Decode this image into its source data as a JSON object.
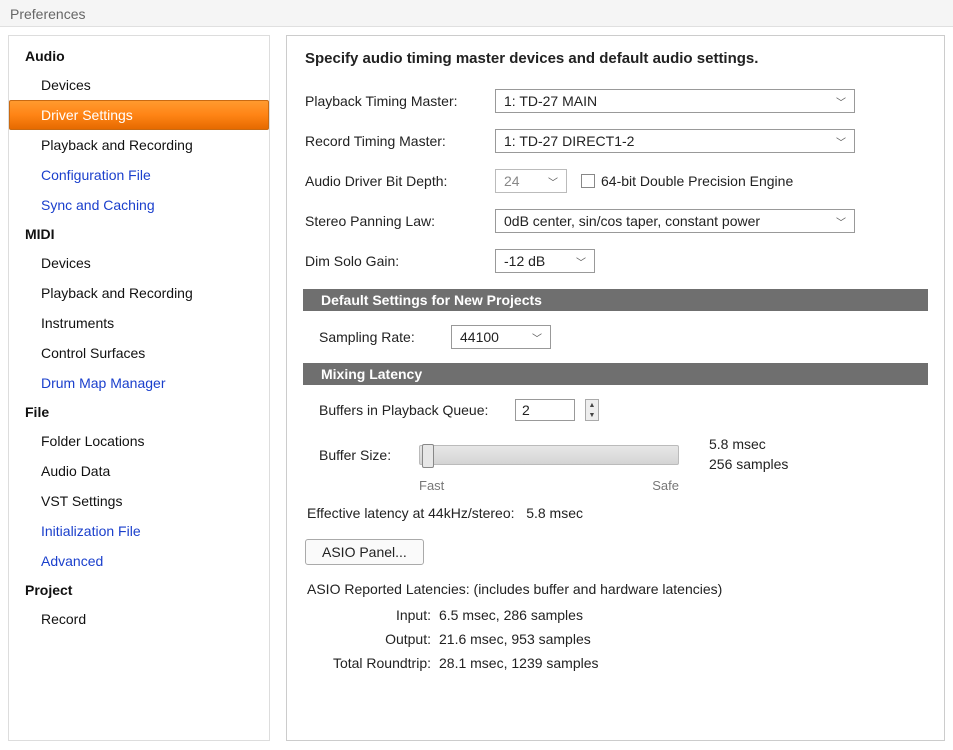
{
  "title": "Preferences",
  "nav": {
    "audio_header": "Audio",
    "audio_items": [
      "Devices",
      "Driver Settings",
      "Playback and Recording",
      "Configuration File",
      "Sync and Caching"
    ],
    "midi_header": "MIDI",
    "midi_items": [
      "Devices",
      "Playback and Recording",
      "Instruments",
      "Control Surfaces",
      "Drum Map Manager"
    ],
    "file_header": "File",
    "file_items": [
      "Folder Locations",
      "Audio Data",
      "VST Settings",
      "Initialization File",
      "Advanced"
    ],
    "project_header": "Project",
    "project_items": [
      "Record"
    ]
  },
  "heading": "Specify audio timing master devices and default audio settings.",
  "rows": {
    "playback_master_label": "Playback Timing Master:",
    "playback_master_value": "1: TD-27 MAIN",
    "record_master_label": "Record Timing Master:",
    "record_master_value": "1: TD-27 DIRECT1-2",
    "bitdepth_label": "Audio Driver Bit Depth:",
    "bitdepth_value": "24",
    "double_precision_label": "64-bit Double Precision Engine",
    "panning_label": "Stereo Panning Law:",
    "panning_value": "0dB center, sin/cos taper, constant power",
    "dimsolo_label": "Dim Solo Gain:",
    "dimsolo_value": "-12 dB"
  },
  "sections": {
    "defaults_title": "Default Settings for New Projects",
    "samplerate_label": "Sampling Rate:",
    "samplerate_value": "44100",
    "mixlat_title": "Mixing Latency",
    "buffers_label": "Buffers in Playback Queue:",
    "buffers_value": "2",
    "bufsize_label": "Buffer Size:",
    "slider_fast": "Fast",
    "slider_safe": "Safe",
    "bufsize_ms": "5.8 msec",
    "bufsize_samples": "256 samples",
    "effective_label": "Effective latency at 44kHz/stereo:",
    "effective_value": "5.8 msec",
    "asio_panel_btn": "ASIO Panel...",
    "asio_reported": "ASIO Reported Latencies: (includes buffer and hardware latencies)",
    "input_label": "Input:",
    "input_value": "6.5 msec, 286 samples",
    "output_label": "Output:",
    "output_value": "21.6 msec, 953 samples",
    "roundtrip_label": "Total Roundtrip:",
    "roundtrip_value": "28.1 msec, 1239 samples"
  }
}
